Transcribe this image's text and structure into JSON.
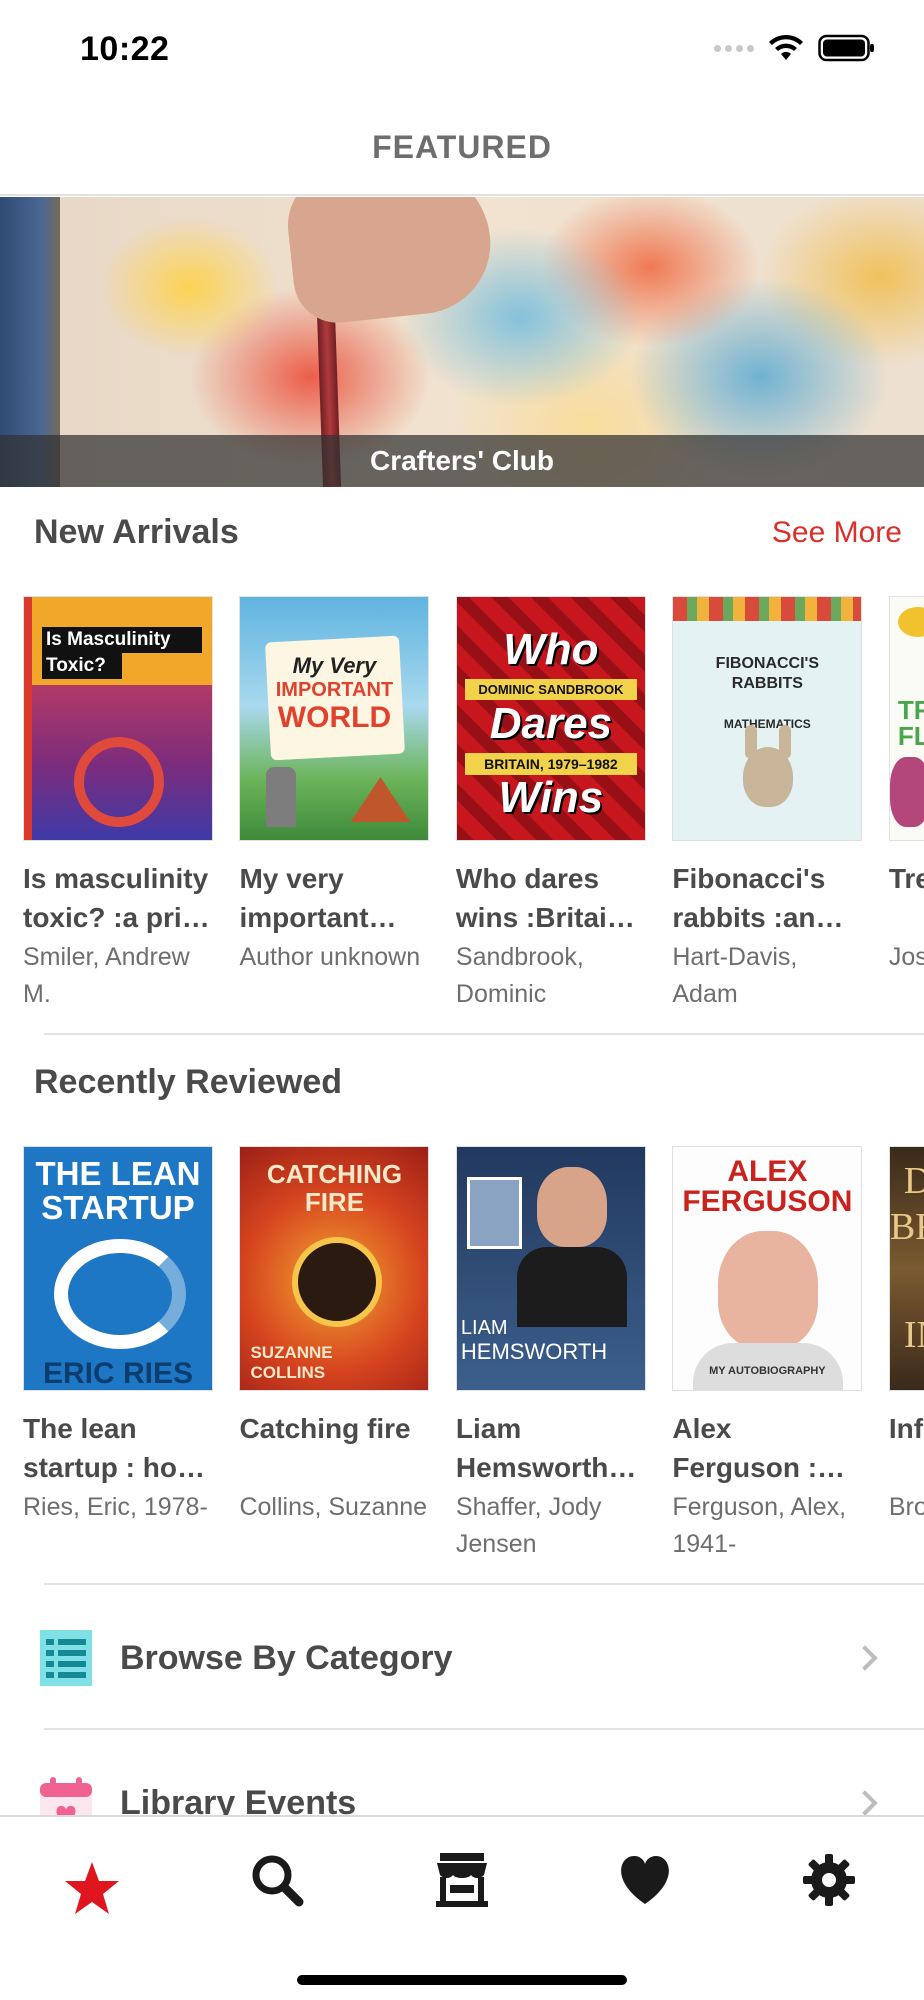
{
  "status_bar": {
    "time": "10:22"
  },
  "header": {
    "title": "FEATURED"
  },
  "hero": {
    "caption": "Crafters' Club"
  },
  "new_arrivals": {
    "title": "New Arrivals",
    "see_more": "See More",
    "books": [
      {
        "title": "Is masculinity toxic? :a pri…",
        "author": "Smiler, Andrew M.",
        "cover_text": [
          "Is Masculinity",
          "Toxic?"
        ]
      },
      {
        "title": "My very important…",
        "author": "Author unknown",
        "cover_text": [
          "My Very",
          "IMPORTANT",
          "WORLD"
        ]
      },
      {
        "title": "Who dares wins :Britai…",
        "author": "Sandbrook, Dominic",
        "cover_text": [
          "Who",
          "DOMINIC SANDBROOK",
          "Dares",
          "BRITAIN, 1979–1982",
          "Wins"
        ]
      },
      {
        "title": "Fibonacci's rabbits :an…",
        "author": "Hart-Davis, Adam",
        "cover_text": [
          "FIBONACCI'S",
          "RABBITS",
          "MATHEMATICS"
        ]
      },
      {
        "title": "Tree flow…",
        "author": "Jose…",
        "cover_text": [
          "TRE",
          "FLOW"
        ]
      }
    ]
  },
  "recently_reviewed": {
    "title": "Recently Reviewed",
    "books": [
      {
        "title": "The lean startup : ho…",
        "author": "Ries, Eric, 1978-",
        "cover_text": [
          "THE LEAN",
          "STARTUP",
          "ERIC RIES"
        ]
      },
      {
        "title": "Catching fire",
        "author": "Collins, Suzanne",
        "cover_text": [
          "CATCHING",
          "FIRE",
          "SUZANNE",
          "COLLINS"
        ]
      },
      {
        "title": "Liam Hemsworth…",
        "author": "Shaffer, Jody Jensen",
        "cover_text": [
          "LIAM",
          "HEMSWORTH"
        ]
      },
      {
        "title": "Alex Ferguson :…",
        "author": "Ferguson, Alex, 1941-",
        "cover_text": [
          "ALEX",
          "FERGUSON",
          "MY AUTOBIOGRAPHY"
        ]
      },
      {
        "title": "Infer a no…",
        "author": "Brow Dan,",
        "cover_text": [
          "D",
          "BR",
          "IN"
        ]
      }
    ]
  },
  "list_rows": [
    {
      "label": "Browse By Category",
      "icon": "list-icon"
    },
    {
      "label": "Library Events",
      "icon": "calendar-icon"
    }
  ],
  "tabs": [
    {
      "name": "featured",
      "icon": "star-icon",
      "active": true
    },
    {
      "name": "search",
      "icon": "search-icon"
    },
    {
      "name": "library",
      "icon": "store-icon"
    },
    {
      "name": "favorites",
      "icon": "heart-icon"
    },
    {
      "name": "settings",
      "icon": "gear-icon"
    }
  ],
  "colors": {
    "accent": "#d9302b",
    "active_tab": "#e0161e",
    "tab_icon": "#1a1a1a",
    "list_icon_bg": "#7fe0e6",
    "calendar_icon": "#f06292"
  }
}
